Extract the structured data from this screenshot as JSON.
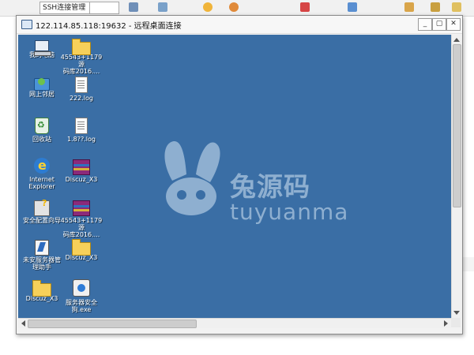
{
  "host": {
    "combo_label": "SSH连接管理"
  },
  "window": {
    "title": "122.114.85.118:19632 - 远程桌面连接",
    "buttons": {
      "minimize": "_",
      "restore": "▢",
      "close": "✕"
    }
  },
  "desktop": {
    "background_color": "#3a6ea5",
    "icons": [
      {
        "label": "我的电脑",
        "icon": "computer-icon"
      },
      {
        "label": "45543+1179源\n码库2016....",
        "icon": "folder-icon"
      },
      {
        "label": "网上邻居",
        "icon": "network-icon"
      },
      {
        "label": "222.log",
        "icon": "document-icon"
      },
      {
        "label": "回收站",
        "icon": "recycle-bin-icon"
      },
      {
        "label": "1.8??.log",
        "icon": "document-icon"
      },
      {
        "label": "Internet\nExplorer",
        "icon": "ie-icon"
      },
      {
        "label": "Discuz_X3",
        "icon": "rar-icon"
      },
      {
        "label": "安全配置向导",
        "icon": "security-wizard-icon"
      },
      {
        "label": "45543+1179源\n码库2016....",
        "icon": "rar-icon"
      },
      {
        "label": "未安服务器管\n理助手",
        "icon": "server-tool-icon"
      },
      {
        "label": "Discuz_X3",
        "icon": "folder-icon"
      },
      {
        "label": "Discuz_X3",
        "icon": "folder-icon"
      },
      {
        "label": "服务器安全\n狗.exe",
        "icon": "safedog-icon"
      }
    ]
  },
  "watermark": {
    "cn": "兔源码",
    "en": "tuyuanma"
  }
}
